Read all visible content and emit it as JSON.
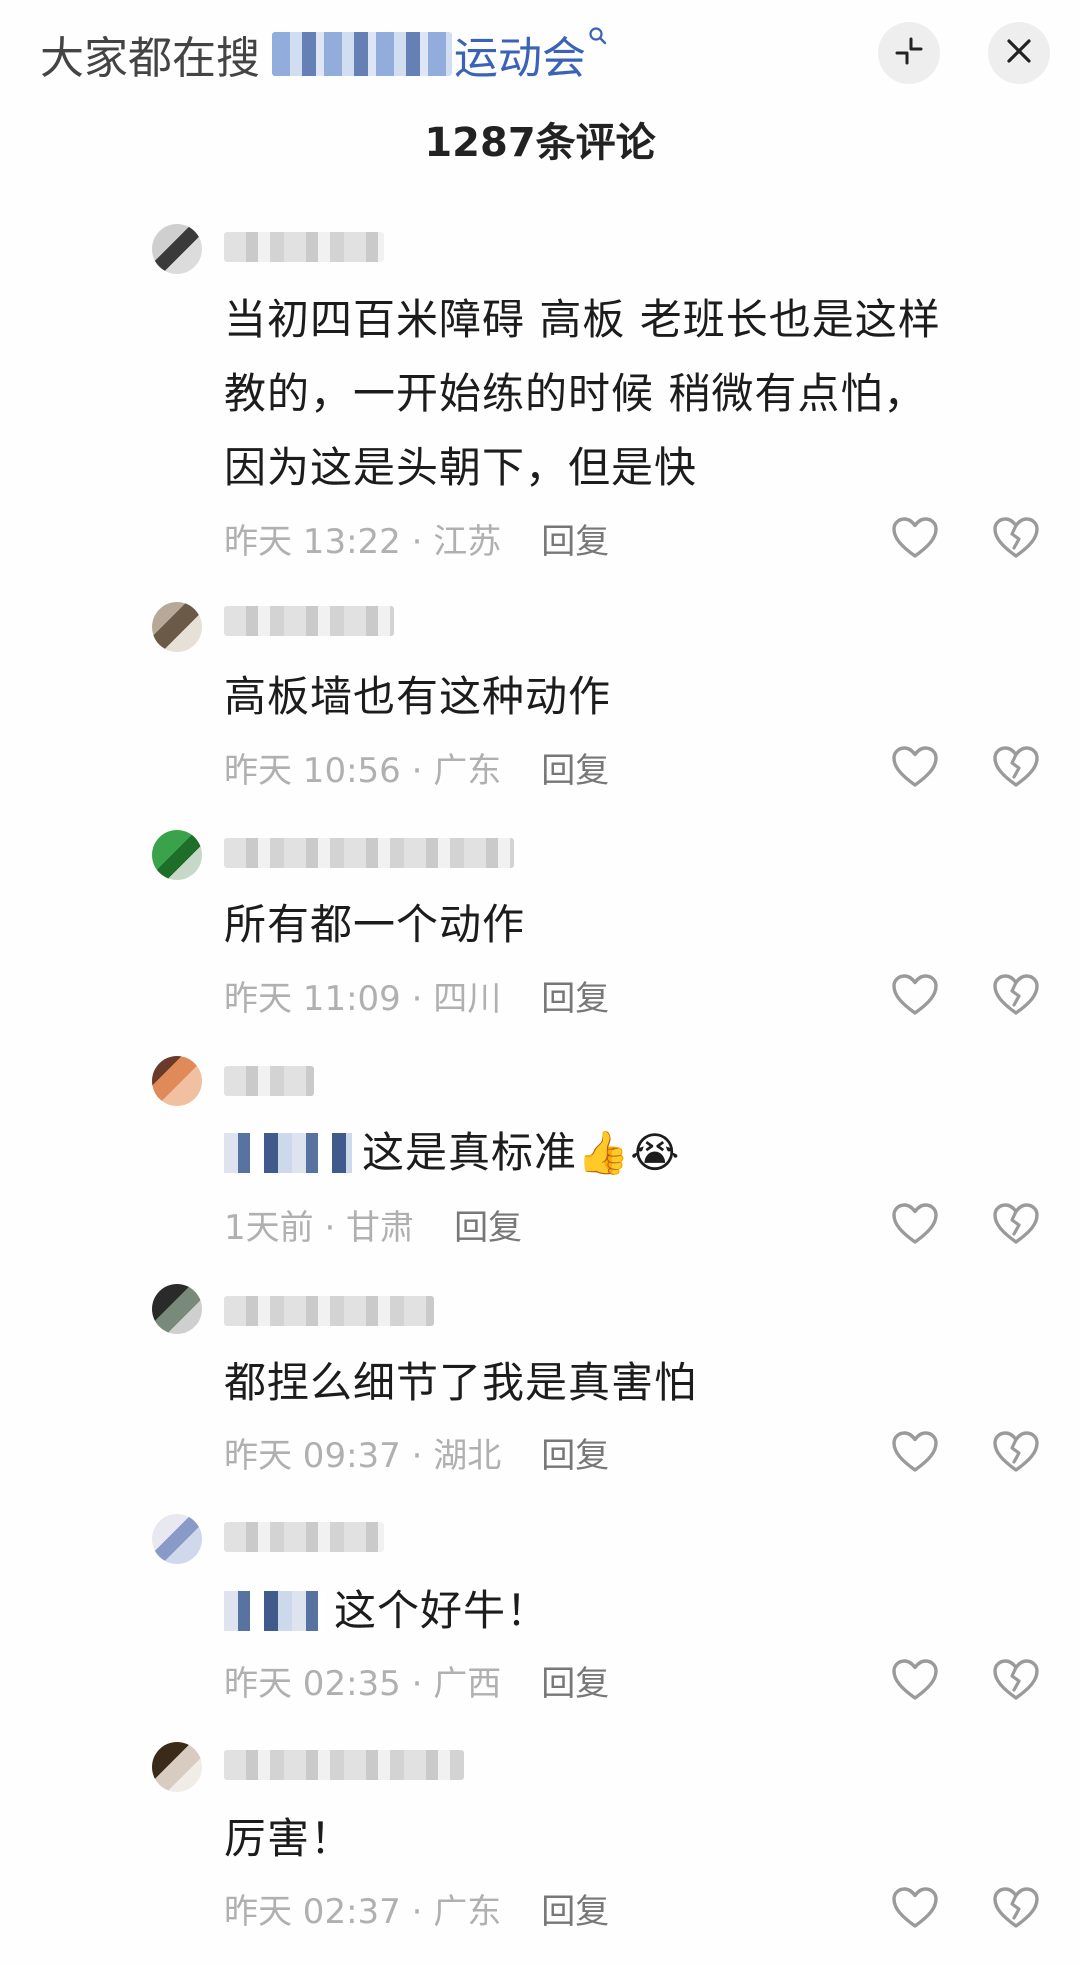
{
  "header": {
    "search_prefix": "大家都在搜",
    "search_term": "运动会",
    "search_icon": "search-icon",
    "minimize_icon": "minimize-icon",
    "close_icon": "close-icon",
    "comment_count": "1287条评论"
  },
  "reply_label": "回复",
  "icons": {
    "like": "heart-icon",
    "dislike": "broken-heart-icon"
  },
  "comments": [
    {
      "text_lines": [
        "当初四百米障碍 高板 老班长也是这样",
        "教的，一开始练的时候 稍微有点怕，",
        "因为这是头朝下，但是快"
      ],
      "meta": "昨天 13:22 · 江苏"
    },
    {
      "text_lines": [
        "高板墙也有这种动作"
      ],
      "meta": "昨天 10:56 · 广东"
    },
    {
      "text_lines": [
        "所有都一个动作"
      ],
      "meta": "昨天 11:09 · 四川"
    },
    {
      "text_lines": [
        "这是真标准👍😭"
      ],
      "meta": "1天前 · 甘肃"
    },
    {
      "text_lines": [
        "都捏么细节了我是真害怕"
      ],
      "meta": "昨天 09:37 · 湖北"
    },
    {
      "text_lines": [
        "这个好牛！"
      ],
      "meta": "昨天 02:35 · 广西"
    },
    {
      "text_lines": [
        "厉害！"
      ],
      "meta": "昨天 02:37 · 广东"
    }
  ]
}
